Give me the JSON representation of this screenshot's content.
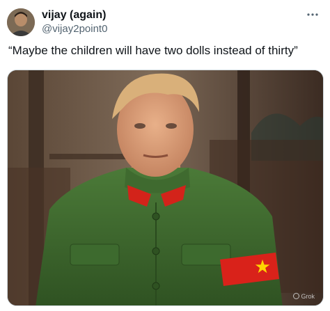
{
  "post": {
    "author": {
      "display_name": "vijay (again)",
      "handle": "@vijay2point0"
    },
    "text": "“Maybe the children will have two dolls instead of thirty”",
    "media": {
      "watermark": "Grok"
    }
  },
  "icons": {
    "more": "more-horizontal-icon",
    "armband": "star-icon",
    "watermark": "grok-logo-icon"
  },
  "colors": {
    "jacket": "#3f6a2f",
    "collar": "#d3231a",
    "armband": "#d9221a",
    "star": "#ffd400"
  }
}
